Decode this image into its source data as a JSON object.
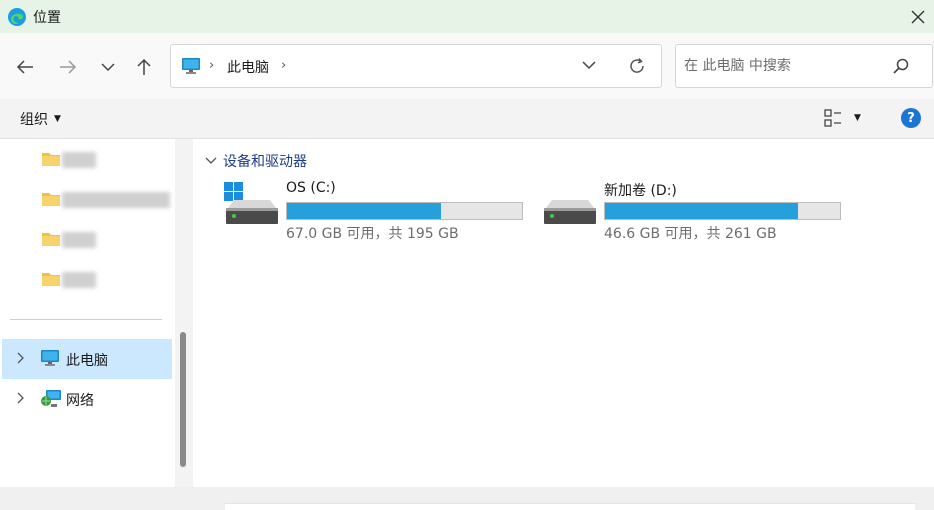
{
  "window": {
    "title": "位置"
  },
  "address": {
    "crumb": "此电脑"
  },
  "search": {
    "placeholder": "在 此电脑 中搜索"
  },
  "toolbar": {
    "organize": "组织"
  },
  "sidebar": {
    "items": [
      {
        "label": "此电脑",
        "selected": true
      },
      {
        "label": "网络",
        "selected": false
      }
    ]
  },
  "content": {
    "group": "设备和驱动器",
    "drives": [
      {
        "name": "OS (C:)",
        "free_text": "67.0 GB 可用，共 195 GB",
        "used_fraction": 0.656
      },
      {
        "name": "新加卷 (D:)",
        "free_text": "46.6 GB 可用，共 261 GB",
        "used_fraction": 0.821
      }
    ]
  },
  "colors": {
    "accent": "#26a0da",
    "selection": "#cce8ff",
    "help": "#1a76d2"
  }
}
